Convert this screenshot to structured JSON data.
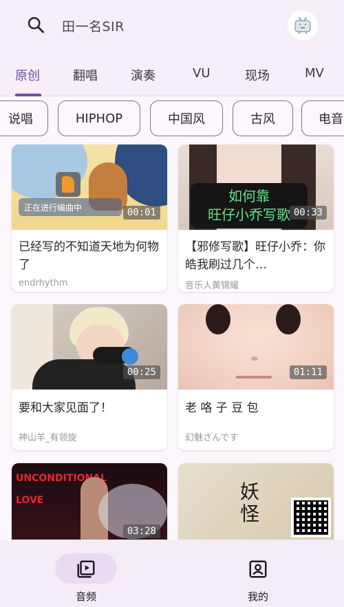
{
  "search": {
    "text": "田一名SIR"
  },
  "tabs": [
    {
      "label": "原创",
      "active": true
    },
    {
      "label": "翻唱",
      "active": false
    },
    {
      "label": "演奏",
      "active": false
    },
    {
      "label": "VU",
      "active": false
    },
    {
      "label": "现场",
      "active": false
    },
    {
      "label": "MV",
      "active": false
    }
  ],
  "chips": [
    "说唱",
    "HIPHOP",
    "中国风",
    "古风",
    "电音"
  ],
  "cards": [
    {
      "title": "已经写的不知道天地为何物了",
      "author": "endrhythm",
      "duration": "00:01",
      "thumb_caption": "正在进行编曲中"
    },
    {
      "title": "【邪修写歌】旺仔小乔：你皓我刷过几个…",
      "author": "音乐人黄锦耀",
      "duration": "00:33",
      "thumb_caption": "如何靠\n旺仔小乔写歌"
    },
    {
      "title": "要和大家见面了！",
      "author": "神山羊_有领旋",
      "duration": "00:25",
      "thumb_caption": ""
    },
    {
      "title": "老 咯 子 豆 包",
      "author": "幻魅さんです",
      "duration": "01:11",
      "thumb_caption": ""
    },
    {
      "title": "",
      "author": "",
      "duration": "03:28",
      "thumb_caption": "UNCONDITIONAL\nLOVE"
    },
    {
      "title": "",
      "author": "",
      "duration": "",
      "thumb_caption": "妖\n怪"
    }
  ],
  "nav": [
    {
      "label": "音频",
      "active": true
    },
    {
      "label": "我的",
      "active": false
    }
  ],
  "colors": {
    "accent": "#6a4fa6",
    "background": "#fbf7fc",
    "topbar": "#f6eef8"
  }
}
